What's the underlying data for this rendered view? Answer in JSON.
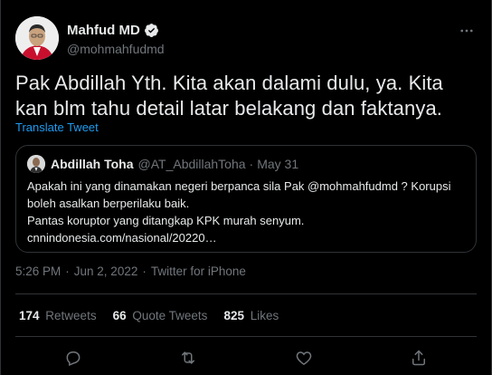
{
  "tweet": {
    "author": {
      "display_name": "Mahfud MD",
      "handle": "@mohmahfudmd",
      "verified": true
    },
    "text": "Pak Abdillah Yth. Kita akan dalami dulu, ya. Kita kan blm tahu detail latar belakang dan faktanya.",
    "translate_label": "Translate Tweet",
    "quoted": {
      "display_name": "Abdillah Toha",
      "handle": "@AT_AbdillahToha",
      "dot": "·",
      "date": "May 31",
      "line1": "Apakah ini yang dinamakan negeri berpanca sila Pak @mohmahfudmd ? Korupsi",
      "line2": "boleh asalkan berperilaku baik.",
      "line3": "Pantas koruptor yang ditangkap KPK murah senyum.",
      "line4": "cnnindonesia.com/nasional/20220…"
    },
    "meta": {
      "time": "5:26 PM",
      "date": "Jun 2, 2022",
      "source": "Twitter for iPhone",
      "sep": "·"
    },
    "stats": {
      "retweets_count": "174",
      "retweets_label": "Retweets",
      "quotes_count": "66",
      "quotes_label": "Quote Tweets",
      "likes_count": "825",
      "likes_label": "Likes"
    },
    "icons": {
      "more": "more-icon",
      "reply": "reply-icon",
      "retweet": "retweet-icon",
      "like": "like-icon",
      "share": "share-icon",
      "verified": "verified-badge-icon"
    }
  },
  "colors": {
    "background": "#000000",
    "text": "#e7e9ea",
    "secondary": "#71767b",
    "accent": "#1d9bf0",
    "border": "#2f3336"
  }
}
